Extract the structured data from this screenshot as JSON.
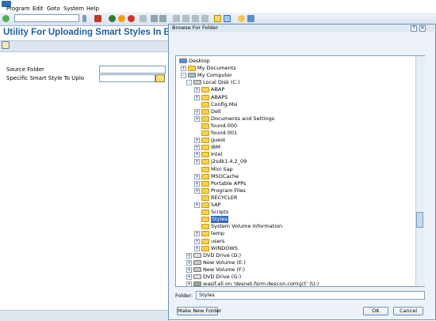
{
  "menu": [
    "Program",
    "Edit",
    "Goto",
    "System",
    "Help"
  ],
  "screen": {
    "title": "Utility For Uploading Smart Styles In Bulk",
    "fields": [
      {
        "label": "Source Folder",
        "value": ""
      },
      {
        "label": "Specific Smart Style To Uplo",
        "value": ""
      }
    ]
  },
  "dialog": {
    "title": "Browse For Folder",
    "tree": [
      {
        "label": "Desktop",
        "icon": "desktop-icon",
        "level": 0,
        "expander": ""
      },
      {
        "label": "My Documents",
        "icon": "folder-icon",
        "level": 1,
        "expander": "+"
      },
      {
        "label": "My Computer",
        "icon": "computer-icon",
        "level": 1,
        "expander": "-"
      },
      {
        "label": "Local Disk (C:)",
        "icon": "drive-icon",
        "level": 2,
        "expander": "-"
      },
      {
        "label": "ABAP",
        "icon": "folder-icon",
        "level": 3,
        "expander": "+"
      },
      {
        "label": "ABAPS",
        "icon": "folder-icon",
        "level": 3,
        "expander": "+"
      },
      {
        "label": "Config.Msi",
        "icon": "folder-icon",
        "level": 3,
        "expander": ""
      },
      {
        "label": "Dell",
        "icon": "folder-icon",
        "level": 3,
        "expander": "+"
      },
      {
        "label": "Documents and Settings",
        "icon": "folder-icon",
        "level": 3,
        "expander": "+"
      },
      {
        "label": "found.000",
        "icon": "folder-icon",
        "level": 3,
        "expander": ""
      },
      {
        "label": "found.001",
        "icon": "folder-icon",
        "level": 3,
        "expander": ""
      },
      {
        "label": "guest",
        "icon": "folder-icon",
        "level": 3,
        "expander": "+"
      },
      {
        "label": "IBM",
        "icon": "folder-icon",
        "level": 3,
        "expander": "+"
      },
      {
        "label": "Intel",
        "icon": "folder-icon",
        "level": 3,
        "expander": "+"
      },
      {
        "label": "j2sdk1.4.2_09",
        "icon": "folder-icon",
        "level": 3,
        "expander": "+"
      },
      {
        "label": "Mini Sap",
        "icon": "folder-icon",
        "level": 3,
        "expander": ""
      },
      {
        "label": "MSOCache",
        "icon": "folder-icon",
        "level": 3,
        "expander": "+"
      },
      {
        "label": "Portable APPs",
        "icon": "folder-icon",
        "level": 3,
        "expander": "+"
      },
      {
        "label": "Program Files",
        "icon": "folder-icon",
        "level": 3,
        "expander": "+"
      },
      {
        "label": "RECYCLER",
        "icon": "folder-icon",
        "level": 3,
        "expander": ""
      },
      {
        "label": "SAP",
        "icon": "folder-icon",
        "level": 3,
        "expander": "+"
      },
      {
        "label": "Scripts",
        "icon": "folder-icon",
        "level": 3,
        "expander": ""
      },
      {
        "label": "Styles",
        "icon": "folder-icon",
        "level": 3,
        "expander": "",
        "selected": true
      },
      {
        "label": "System Volume Information",
        "icon": "folder-icon",
        "level": 3,
        "expander": ""
      },
      {
        "label": "temp",
        "icon": "folder-icon",
        "level": 3,
        "expander": "+"
      },
      {
        "label": "users",
        "icon": "folder-icon",
        "level": 3,
        "expander": "+"
      },
      {
        "label": "WINDOWS",
        "icon": "folder-icon",
        "level": 3,
        "expander": "+"
      },
      {
        "label": "DVD Drive (D:)",
        "icon": "dvd-icon",
        "level": 2,
        "expander": "+"
      },
      {
        "label": "New Volume (E:)",
        "icon": "drive-icon",
        "level": 2,
        "expander": "+"
      },
      {
        "label": "New Volume (F:)",
        "icon": "drive-icon",
        "level": 2,
        "expander": "+"
      },
      {
        "label": "DVD Drive (G:)",
        "icon": "dvd-icon",
        "level": 2,
        "expander": "+"
      },
      {
        "label": "wasif.ali on 'desnet-fsrm.descon.com\\jct' (U:)",
        "icon": "network-drive-icon",
        "level": 2,
        "expander": "+"
      }
    ],
    "folder_label": "Folder:",
    "folder_value": "Styles",
    "buttons": {
      "new_folder": "Make New Folder",
      "ok": "OK",
      "cancel": "Cancel"
    }
  }
}
